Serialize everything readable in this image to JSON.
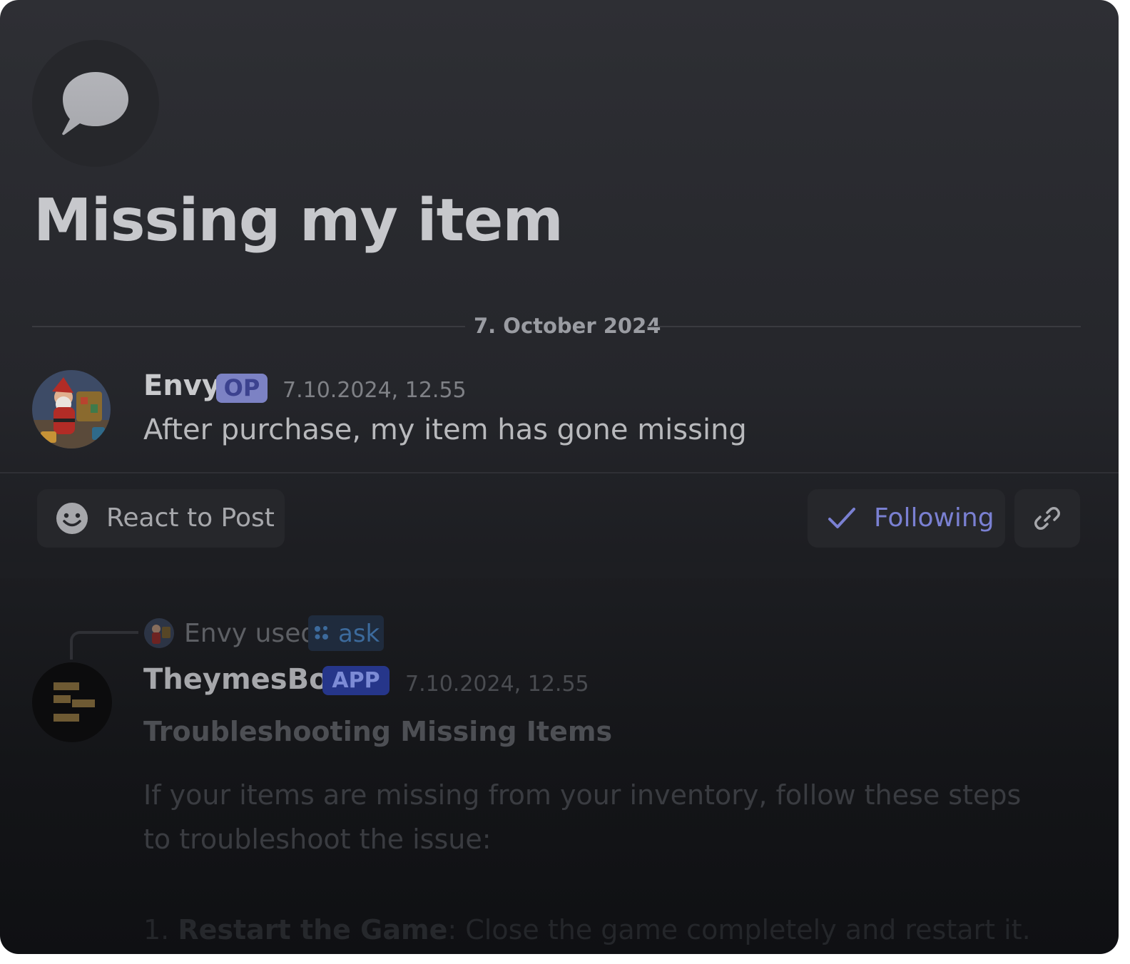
{
  "thread": {
    "title": "Missing my item",
    "icon": "chat-bubble-icon"
  },
  "date_divider": "7. October 2024",
  "op_message": {
    "author": "Envy",
    "badge": "OP",
    "timestamp": "7.10.2024, 12.55",
    "text": "After purchase, my item has gone missing"
  },
  "actions": {
    "react_label": "React to Post",
    "react_icon": "smiley-face-icon",
    "following_label": "Following",
    "following_icon": "checkmark-icon",
    "link_icon": "link-icon"
  },
  "bot_message": {
    "invoker": "Envy used",
    "command": "ask",
    "author": "TheymesBot",
    "badge": "APP",
    "timestamp": "7.10.2024, 12.55",
    "embed_title": "Troubleshooting Missing Items",
    "embed_description": "If your items are missing from your inventory, follow these steps to troubleshoot the issue:",
    "step_number": "1.",
    "step_title": "Restart the Game",
    "step_text": ": Close the game completely and restart it."
  },
  "colors": {
    "accent": "#7a80d2",
    "op_badge_bg": "#7c82c4",
    "app_badge_bg": "#26368a"
  }
}
